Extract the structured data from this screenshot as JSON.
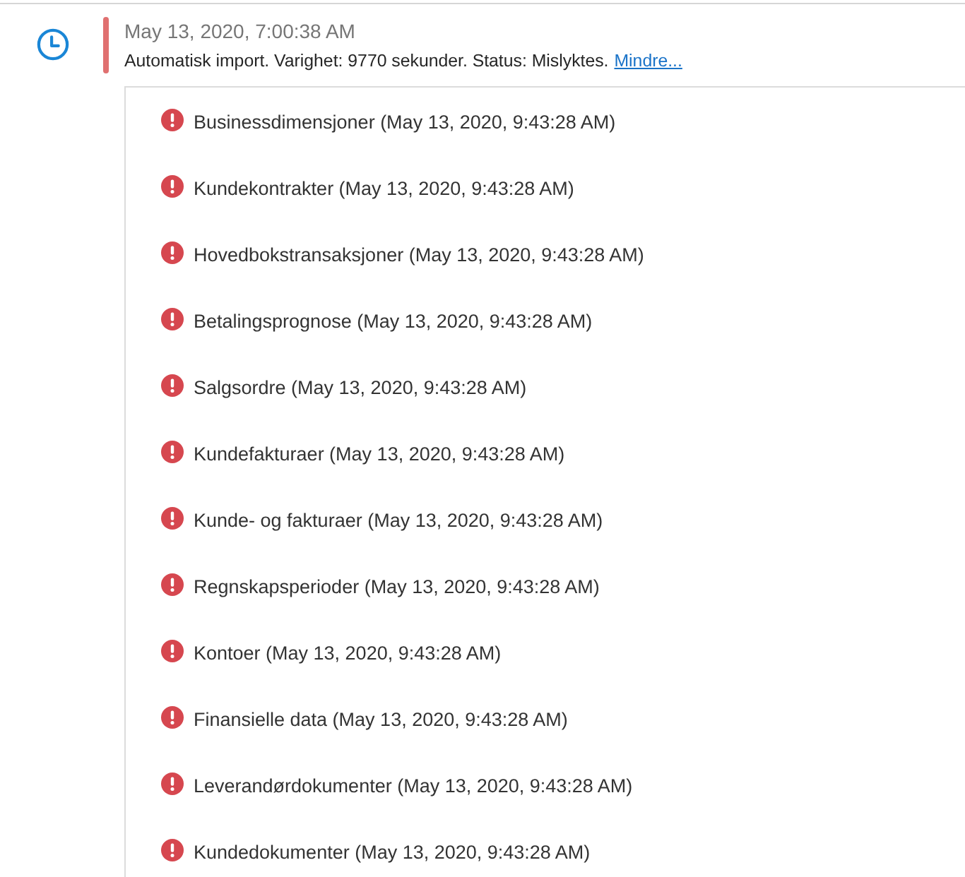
{
  "entry": {
    "timestamp": "May 13, 2020, 7:00:38 AM",
    "failed": true,
    "description": "Automatisk import. Varighet: 9770 sekunder. Status: Mislyktes.",
    "link": "Mindre..."
  },
  "details": [
    {
      "kind": "error",
      "text": "Businessdimensjoner (May 13, 2020, 9:43:28 AM)"
    },
    {
      "kind": "error",
      "text": "Kundekontrakter (May 13, 2020, 9:43:28 AM)"
    },
    {
      "kind": "error",
      "text": "Hovedbokstransaksjoner (May 13, 2020, 9:43:28 AM)"
    },
    {
      "kind": "error",
      "text": "Betalingsprognose (May 13, 2020, 9:43:28 AM)"
    },
    {
      "kind": "error",
      "text": "Salgsordre (May 13, 2020, 9:43:28 AM)"
    },
    {
      "kind": "error",
      "text": "Kundefakturaer (May 13, 2020, 9:43:28 AM)"
    },
    {
      "kind": "error",
      "text": "Kunde- og fakturaer (May 13, 2020, 9:43:28 AM)"
    },
    {
      "kind": "error",
      "text": "Regnskapsperioder (May 13, 2020, 9:43:28 AM)"
    },
    {
      "kind": "error",
      "text": "Kontoer (May 13, 2020, 9:43:28 AM)"
    },
    {
      "kind": "error",
      "text": "Finansielle data (May 13, 2020, 9:43:28 AM)"
    },
    {
      "kind": "error",
      "text": "Leverandørdokumenter (May 13, 2020, 9:43:28 AM)"
    },
    {
      "kind": "error",
      "text": "Kundedokumenter (May 13, 2020, 9:43:28 AM)"
    }
  ]
}
